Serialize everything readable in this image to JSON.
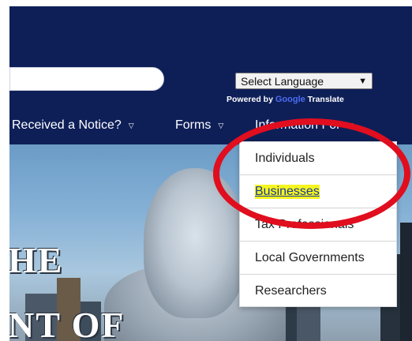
{
  "header": {
    "background": "#0e1f58",
    "search": {
      "value": "",
      "placeholder": ""
    },
    "language": {
      "selected": "Select Language"
    },
    "powered": {
      "prefix": "Powered by",
      "brand": "Google",
      "suffix": "Translate"
    }
  },
  "nav": {
    "items": [
      {
        "label": "Received a Notice?"
      },
      {
        "label": "Forms"
      },
      {
        "label": "Information For"
      }
    ]
  },
  "hero": {
    "text_line1": "HE",
    "text_line2": "NT OF"
  },
  "dropdown": {
    "items": [
      {
        "label": "Individuals"
      },
      {
        "label": "Businesses"
      },
      {
        "label": "Tax Professionals"
      },
      {
        "label": "Local Governments"
      },
      {
        "label": "Researchers"
      }
    ],
    "highlighted_index": 1,
    "highlight_color": "#f5f520"
  },
  "annotation": {
    "color": "#e00e1e",
    "shape": "oval"
  }
}
